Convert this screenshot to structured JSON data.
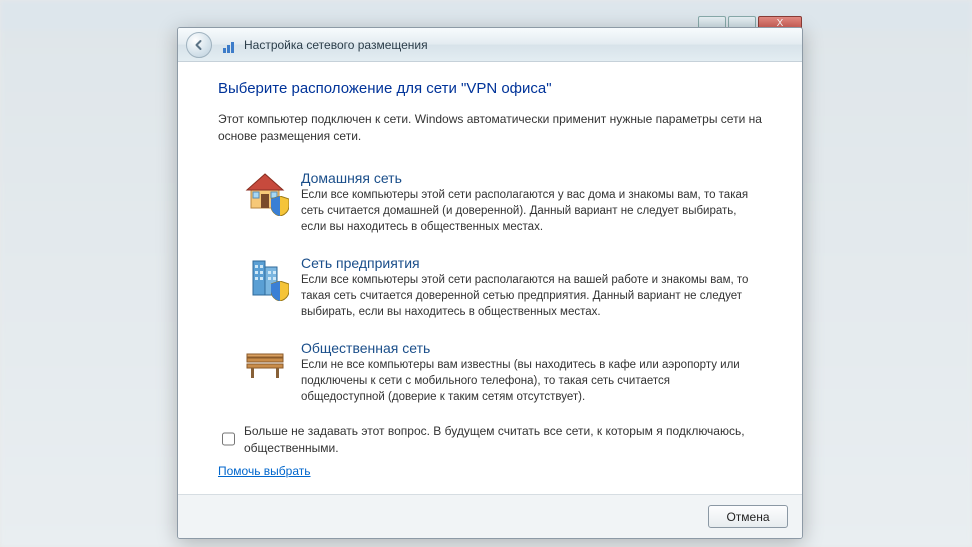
{
  "titlebar": {
    "title": "Настройка сетевого размещения"
  },
  "heading": "Выберите расположение для сети \"VPN офиса\"",
  "intro": "Этот компьютер подключен к сети. Windows автоматически применит нужные параметры сети на основе размещения сети.",
  "options": [
    {
      "title": "Домашняя сеть",
      "desc": "Если все компьютеры этой сети располагаются у вас дома и знакомы вам, то такая сеть считается домашней (и доверенной). Данный вариант не следует выбирать, если вы находитесь в общественных местах."
    },
    {
      "title": "Сеть предприятия",
      "desc": "Если все компьютеры этой сети располагаются на вашей работе и знакомы вам, то такая сеть считается доверенной сетью предприятия. Данный вариант не следует выбирать, если вы находитесь в общественных местах."
    },
    {
      "title": "Общественная сеть",
      "desc": "Если не все компьютеры вам известны (вы находитесь в кафе или аэропорту или подключены к сети с мобильного телефона), то такая сеть считается общедоступной (доверие к таким сетям отсутствует)."
    }
  ],
  "checkbox_label": "Больше не задавать этот вопрос. В будущем считать все сети, к которым я подключаюсь, общественными.",
  "help_link": "Помочь выбрать",
  "footer": {
    "cancel": "Отмена"
  },
  "bg_close": "X"
}
